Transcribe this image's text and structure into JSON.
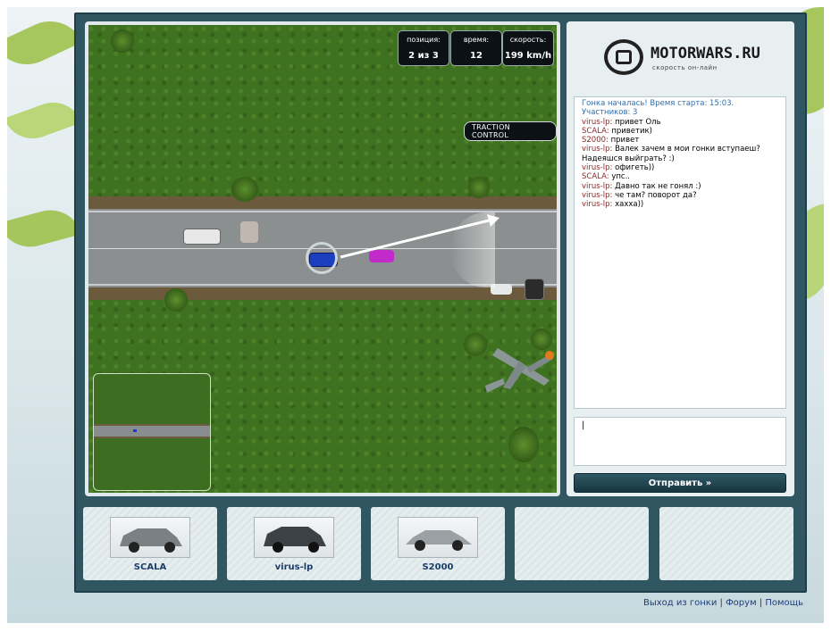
{
  "hud": {
    "position_label": "позиция:",
    "position_value": "2 из 3",
    "time_label": "время:",
    "time_value": "12",
    "speed_label": "скорость:",
    "speed_value": "199 km/h"
  },
  "traction_control_label": "TRACTION CONTROL",
  "logo": {
    "title": "MOTORWARS.RU",
    "subtitle": "скорость он-лайн"
  },
  "chat": {
    "messages": [
      {
        "type": "system",
        "user": "",
        "text": "Гонка началась! Время старта: 15:03. Участников: 3"
      },
      {
        "type": "user",
        "user": "virus-lp:",
        "text": "привет Оль"
      },
      {
        "type": "user",
        "user": "SCALA:",
        "text": "приветик)"
      },
      {
        "type": "user",
        "user": "S2000:",
        "text": "привет"
      },
      {
        "type": "user",
        "user": "virus-lp:",
        "text": "Валек зачем в мои гонки вступаеш? Надеяшся выйграть? :)"
      },
      {
        "type": "user",
        "user": "virus-lp:",
        "text": "офигеть))"
      },
      {
        "type": "user",
        "user": "SCALA:",
        "text": "упс.."
      },
      {
        "type": "user",
        "user": "virus-lp:",
        "text": "Давно так не гонял :)"
      },
      {
        "type": "user",
        "user": "virus-lp:",
        "text": "че там? поворот да?"
      },
      {
        "type": "user",
        "user": "virus-lp:",
        "text": "хахха))"
      }
    ],
    "input_value": "|",
    "send_label": "Отправить »"
  },
  "players": [
    {
      "name": "SCALA"
    },
    {
      "name": "virus-lp"
    },
    {
      "name": "S2000"
    },
    {
      "name": ""
    },
    {
      "name": ""
    }
  ],
  "footer": {
    "exit_label": "Выход из гонки",
    "forum_label": "Форум",
    "help_label": "Помощь",
    "separator": "|"
  },
  "colors": {
    "frame": "#2f5661",
    "chat_system": "#2f6fb0",
    "chat_user": "#8a2a2a",
    "link": "#1e3e78"
  }
}
